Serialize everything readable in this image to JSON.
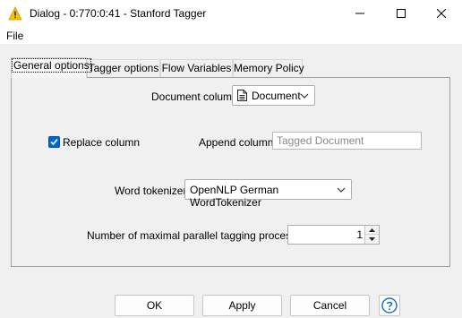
{
  "window": {
    "title": "Dialog - 0:770:0:41 - Stanford Tagger",
    "app_icon": "knime-triangle-icon",
    "minimize_icon": "minimize-icon",
    "maximize_icon": "maximize-icon",
    "close_icon": "close-icon"
  },
  "menu": {
    "file": "File"
  },
  "tabs": [
    {
      "label": "General options",
      "active": true
    },
    {
      "label": "Tagger options",
      "active": false
    },
    {
      "label": "Flow Variables",
      "active": false
    },
    {
      "label": "Memory Policy",
      "active": false
    }
  ],
  "form": {
    "document_column_label": "Document column",
    "document_column_value": "Document",
    "replace_column_label": "Replace column",
    "replace_column_checked": true,
    "append_column_label": "Append column:",
    "append_column_placeholder": "Tagged Document",
    "word_tokenizer_label": "Word tokenizer",
    "word_tokenizer_value": "OpenNLP German WordTokenizer",
    "parallel_label": "Number of maximal parallel tagging processes",
    "parallel_value": "1"
  },
  "buttons": {
    "ok": "OK",
    "apply": "Apply",
    "cancel": "Cancel",
    "help_icon": "help-icon"
  },
  "colors": {
    "accent": "#0066cc",
    "app_icon": "#f5c400",
    "help_icon": "#1a73c8"
  }
}
